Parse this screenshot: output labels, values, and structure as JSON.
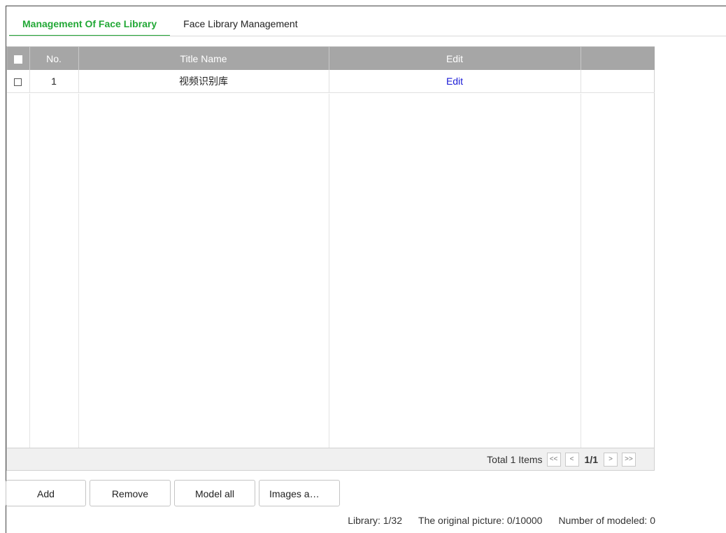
{
  "tabs": [
    {
      "label": "Management Of Face Library",
      "active": true
    },
    {
      "label": "Face Library Management",
      "active": false
    }
  ],
  "table": {
    "headers": {
      "no": "No.",
      "title": "Title Name",
      "edit": "Edit",
      "extra": ""
    },
    "rows": [
      {
        "no": "1",
        "title": "视频识别库",
        "edit": "Edit",
        "checked": false
      }
    ]
  },
  "pager": {
    "total": "Total 1 Items",
    "first": "<<",
    "prev": "<",
    "page": "1/1",
    "next": ">",
    "last": ">>"
  },
  "buttons": {
    "add": "Add",
    "remove": "Remove",
    "model_all": "Model all",
    "images": "Images a…"
  },
  "status": {
    "library": "Library: 1/32",
    "original": "The original picture: 0/10000",
    "modeled": "Number of modeled: 0"
  },
  "colors": {
    "accent": "#22a836",
    "header_bg": "#a6a6a6",
    "link": "#1a1ad6"
  }
}
